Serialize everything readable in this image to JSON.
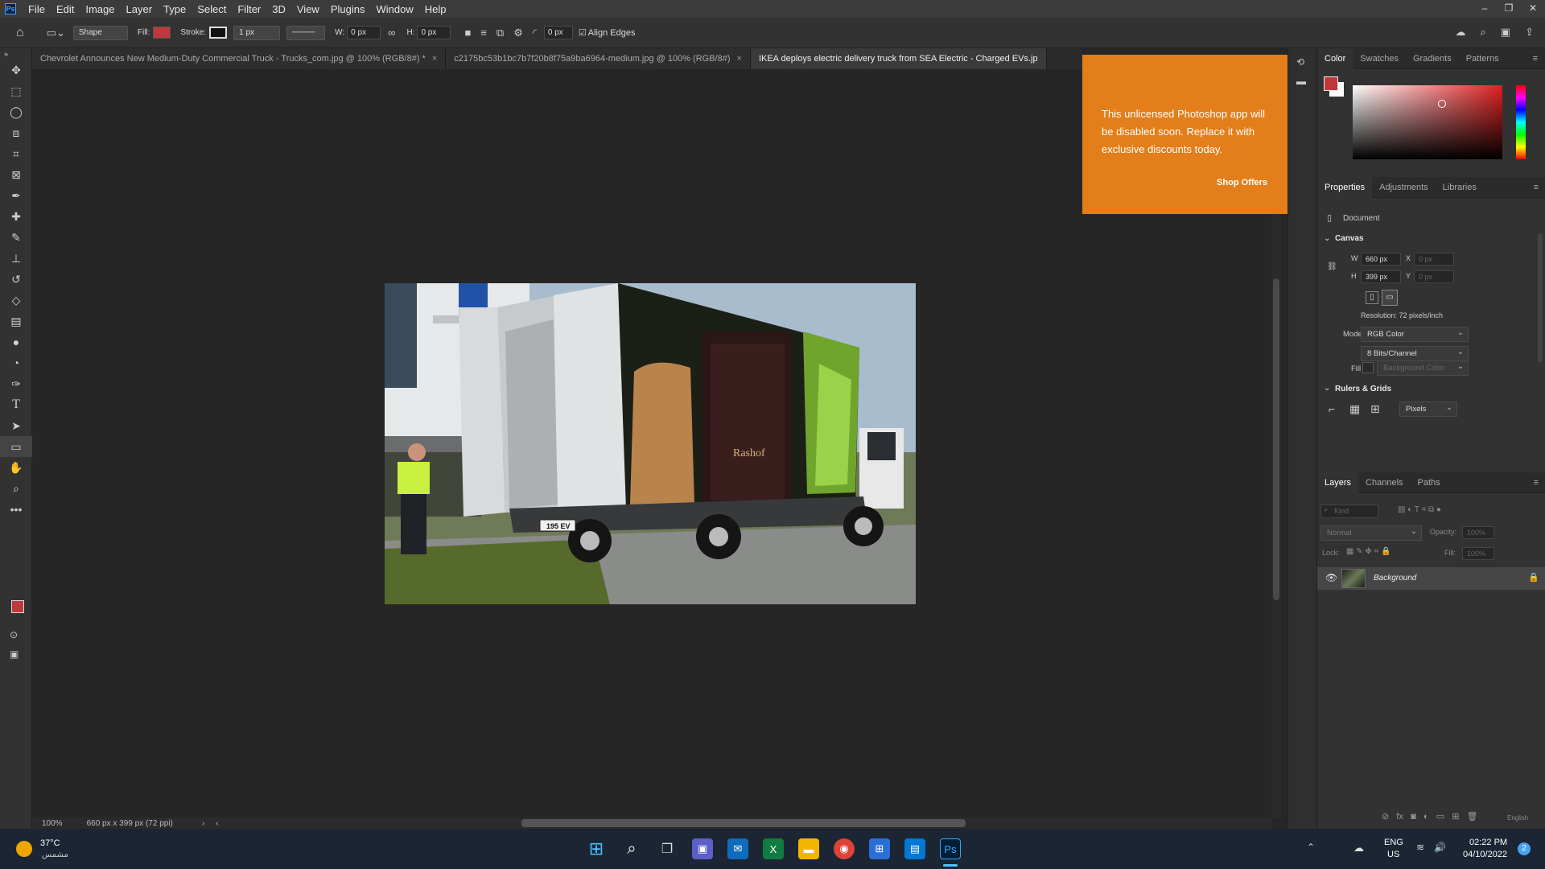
{
  "menu": {
    "items": [
      "File",
      "Edit",
      "Image",
      "Layer",
      "Type",
      "Select",
      "Filter",
      "3D",
      "View",
      "Plugins",
      "Window",
      "Help"
    ]
  },
  "options": {
    "tool_mode": "Shape",
    "fill_label": "Fill:",
    "stroke_label": "Stroke:",
    "stroke_width": "1 px",
    "w_label": "W:",
    "w_value": "0 px",
    "h_label": "H:",
    "h_value": "0 px",
    "radius": "0 px",
    "align_edges": "Align Edges",
    "fill_color": "#c0383b"
  },
  "tabs": [
    {
      "label": "Chevrolet Announces New Medium-Duty Commercial Truck - Trucks_com.jpg @ 100% (RGB/8#) *",
      "active": false
    },
    {
      "label": "c2175bc53b1bc7b7f20b8f75a9ba6964-medium.jpg @ 100% (RGB/8#)",
      "active": false
    },
    {
      "label": "IKEA deploys electric delivery truck from SEA Electric - Charged EVs.jp",
      "active": true
    }
  ],
  "notification": {
    "message": "This unlicensed Photoshop app will be disabled soon. Replace it with exclusive discounts today.",
    "action": "Shop Offers"
  },
  "status": {
    "zoom": "100%",
    "doc_info": "660 px x 399 px (72 ppi)"
  },
  "image": {
    "plate": "195 EV",
    "brand": "Rashof"
  },
  "color_panel": {
    "tabs": [
      "Color",
      "Swatches",
      "Gradients",
      "Patterns"
    ],
    "fg": "#c0383b",
    "bg": "#ffffff"
  },
  "properties": {
    "tabs": [
      "Properties",
      "Adjustments",
      "Libraries"
    ],
    "doc_label": "Document",
    "canvas_title": "Canvas",
    "w_label": "W",
    "w": "660 px",
    "x_label": "X",
    "x": "0 px",
    "h_label": "H",
    "h": "399 px",
    "y_label": "Y",
    "y": "0 px",
    "resolution": "Resolution: 72 pixels/inch",
    "mode_label": "Mode",
    "mode": "RGB Color",
    "bits": "8 Bits/Channel",
    "fill_label": "Fill",
    "fill": "Background Color",
    "rulers_title": "Rulers & Grids",
    "units": "Pixels"
  },
  "layers": {
    "tabs": [
      "Layers",
      "Channels",
      "Paths"
    ],
    "kind": "Kind",
    "blend": "Normal",
    "opacity_label": "Opacity:",
    "opacity": "100%",
    "lock_label": "Lock:",
    "fill_label": "Fill:",
    "fill": "100%",
    "items": [
      {
        "name": "Background",
        "visible": true,
        "locked": true
      }
    ]
  },
  "taskbar": {
    "temp": "37°C",
    "weather": "مشمس",
    "lang1": "ENG",
    "lang2": "US",
    "time": "02:22 PM",
    "date": "04/10/2022",
    "badge": "2"
  },
  "ime_hint": "English"
}
